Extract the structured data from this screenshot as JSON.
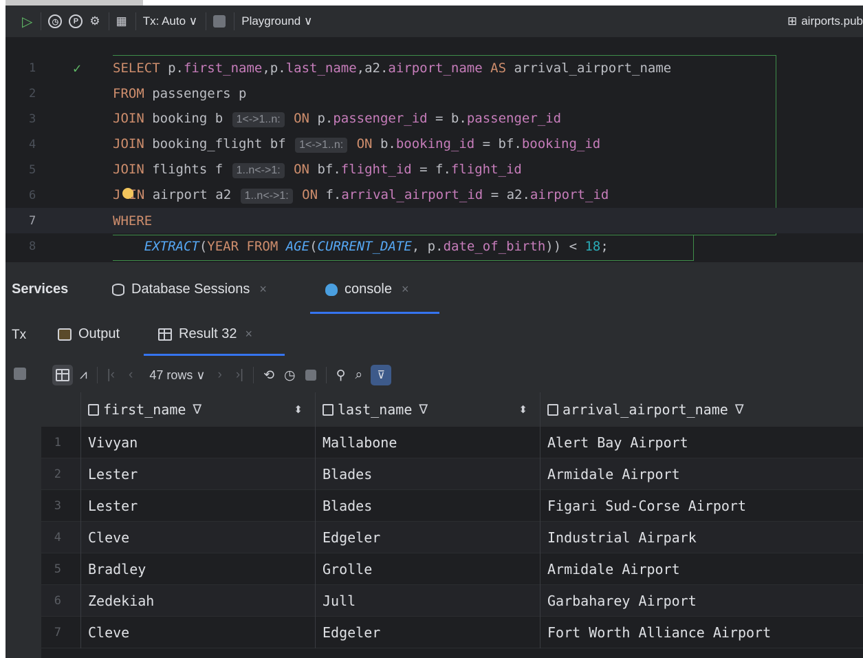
{
  "toolbar": {
    "tx_mode": "Tx: Auto ∨",
    "session": "Playground ∨",
    "datasource": "airports.pub"
  },
  "editor": {
    "lines": [
      {
        "num": "1"
      },
      {
        "num": "2"
      },
      {
        "num": "3"
      },
      {
        "num": "4"
      },
      {
        "num": "5"
      },
      {
        "num": "6"
      },
      {
        "num": "7"
      },
      {
        "num": "8"
      }
    ],
    "tokens": {
      "l1": [
        "SELECT",
        " p.",
        "first_name",
        ",p.",
        "last_name",
        ",a2.",
        "airport_name",
        " ",
        "AS",
        " arrival_airport_name"
      ],
      "l2": [
        "FROM",
        " passengers p"
      ],
      "l3": [
        "JOIN",
        " booking b ",
        "1<->1..n:",
        " ",
        "ON",
        " p.",
        "passenger_id",
        " = b.",
        "passenger_id"
      ],
      "l4": [
        "JOIN",
        " booking_flight bf ",
        "1<->1..n:",
        " ",
        "ON",
        " b.",
        "booking_id",
        " = bf.",
        "booking_id"
      ],
      "l5": [
        "JOIN",
        " flights f ",
        "1..n<->1:",
        " ",
        "ON",
        " bf.",
        "flight_id",
        " = f.",
        "flight_id"
      ],
      "l6": [
        "J",
        "IN",
        " airport a2 ",
        "1..n<->1:",
        " ",
        "ON",
        " f.",
        "arrival_airport_id",
        " = a2.",
        "airport_id"
      ],
      "l7": [
        "WHERE"
      ],
      "l8": [
        "    ",
        "EXTRACT",
        "(",
        "YEAR",
        " ",
        "FROM",
        " ",
        "AGE",
        "(",
        "CURRENT_DATE",
        ", p.",
        "date_of_birth",
        ")) < ",
        "18",
        ";"
      ]
    }
  },
  "services": {
    "title": "Services",
    "tabs": [
      {
        "label": "Database Sessions"
      },
      {
        "label": "console"
      }
    ],
    "close": "×"
  },
  "results": {
    "tx_label": "Tx",
    "tabs": [
      {
        "label": "Output"
      },
      {
        "label": "Result 32"
      }
    ],
    "rows_label": "47 rows ∨",
    "columns": [
      {
        "name": "first_name"
      },
      {
        "name": "last_name"
      },
      {
        "name": "arrival_airport_name"
      }
    ],
    "rows": [
      {
        "n": "1",
        "first_name": "Vivyan",
        "last_name": "Mallabone",
        "arrival": "Alert Bay Airport"
      },
      {
        "n": "2",
        "first_name": "Lester",
        "last_name": "Blades",
        "arrival": "Armidale Airport"
      },
      {
        "n": "3",
        "first_name": "Lester",
        "last_name": "Blades",
        "arrival": "Figari Sud-Corse Airport"
      },
      {
        "n": "4",
        "first_name": "Cleve",
        "last_name": "Edgeler",
        "arrival": "Industrial Airpark"
      },
      {
        "n": "5",
        "first_name": "Bradley",
        "last_name": "Grolle",
        "arrival": "Armidale Airport"
      },
      {
        "n": "6",
        "first_name": "Zedekiah",
        "last_name": "Jull",
        "arrival": "Garbaharey Airport"
      },
      {
        "n": "7",
        "first_name": "Cleve",
        "last_name": "Edgeler",
        "arrival": "Fort Worth Alliance Airport"
      }
    ]
  },
  "colors": {
    "run_green": "#5fb865",
    "keyword": "#cf8e6d",
    "field": "#c77dbb",
    "function": "#56a8f5",
    "accent_blue": "#3574f0"
  }
}
